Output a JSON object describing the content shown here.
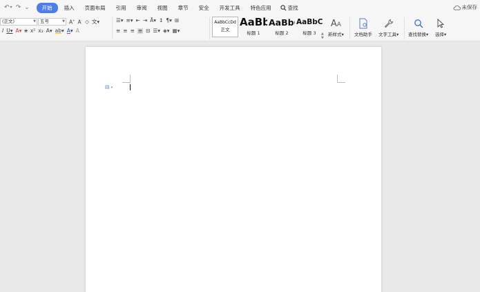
{
  "quick_access": {
    "undo": "↶",
    "undo_dd": "▾",
    "redo": "↷",
    "more": "⌄"
  },
  "tabs": [
    {
      "label": "开始",
      "active": true
    },
    {
      "label": "插入"
    },
    {
      "label": "页面布局"
    },
    {
      "label": "引用"
    },
    {
      "label": "审阅"
    },
    {
      "label": "视图"
    },
    {
      "label": "章节"
    },
    {
      "label": "安全"
    },
    {
      "label": "开发工具"
    },
    {
      "label": "特色应用"
    }
  ],
  "search_label": "查找",
  "unsaved_label": "未保存",
  "font": {
    "name": "(正文)",
    "size": "五号"
  },
  "styles": [
    {
      "preview": "AaBbCcDd",
      "label": "正文"
    },
    {
      "preview": "AaBb",
      "label": "标题 1"
    },
    {
      "preview": "AaBbC",
      "label": "标题 2"
    },
    {
      "preview": "AaBbC",
      "label": "标题 3"
    }
  ],
  "buttons": {
    "new_style": "新样式",
    "doc_helper": "文档助手",
    "text_tools": "文字工具",
    "find_replace": "查找替换",
    "select": "选择"
  },
  "colors": {
    "accent": "#4e7de9",
    "page": "#ffffff",
    "background": "#e9e9e9"
  }
}
